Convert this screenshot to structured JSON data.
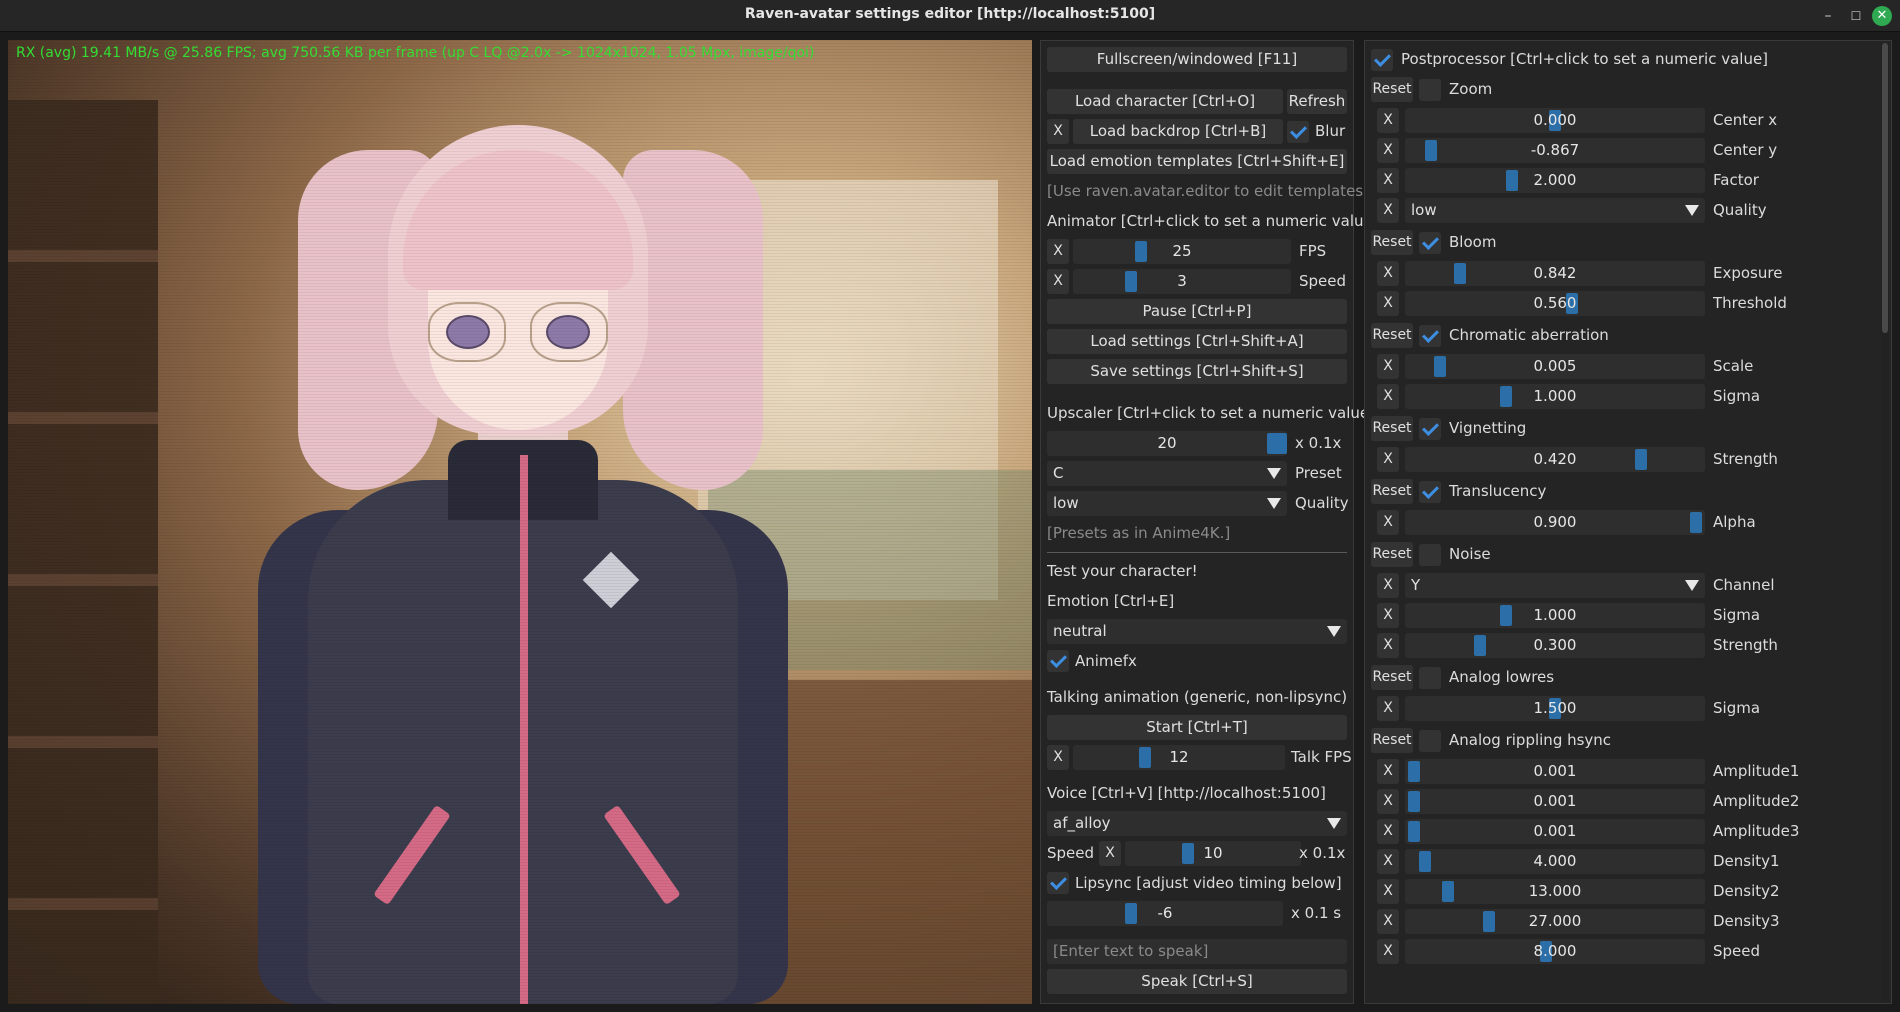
{
  "window": {
    "title": "Raven-avatar settings editor [http://localhost:5100]",
    "controls": {
      "minimize": "–",
      "maximize": "☐",
      "close": "✕"
    }
  },
  "viewport": {
    "stats": "RX (avg) 19.41 MB/s @ 25.86 FPS; avg 750.56 KB per frame (up C LQ @2.0x -> 1024x1024, 1.05 Mpx, image/qoi)"
  },
  "mid": {
    "fullscreen": "Fullscreen/windowed [F11]",
    "load_character": "Load character [Ctrl+O]",
    "refresh": "Refresh",
    "backdrop_x": "X",
    "load_backdrop": "Load backdrop [Ctrl+B]",
    "blur_label": "Blur",
    "blur_checked": true,
    "load_templates": "Load emotion templates [Ctrl+Shift+E]",
    "templates_hint": "[Use raven.avatar.editor to edit templates.]",
    "animator_header": "Animator [Ctrl+click to set a numeric value]",
    "fps": {
      "x": "X",
      "value": "25",
      "label": "FPS",
      "level": 0.3
    },
    "speed": {
      "x": "X",
      "value": "3",
      "label": "Speed",
      "level": 0.25
    },
    "pause": "Pause [Ctrl+P]",
    "load_settings": "Load settings [Ctrl+Shift+A]",
    "save_settings": "Save settings [Ctrl+Shift+S]",
    "upscaler_header": "Upscaler [Ctrl+click to set a numeric value]",
    "upscale": {
      "value": "20",
      "label": "x 0.1x",
      "level": 1.0
    },
    "preset": {
      "value": "C",
      "label": "Preset"
    },
    "quality": {
      "value": "low",
      "label": "Quality"
    },
    "presets_hint": "[Presets as in Anime4K.]",
    "test_header": "Test your character!",
    "emotion_label": "Emotion [Ctrl+E]",
    "emotion_value": "neutral",
    "animefx_label": "Animefx",
    "animefx_checked": true,
    "talking_header": "Talking animation (generic, non-lipsync)",
    "start": "Start [Ctrl+T]",
    "talk_fps": {
      "x": "X",
      "value": "12",
      "label": "Talk FPS",
      "level": 0.33
    },
    "voice_header": "Voice [Ctrl+V] [http://localhost:5100]",
    "voice_value": "af_alloy",
    "voice_speed": {
      "label": "Speed",
      "x": "X",
      "value": "10",
      "unit": "x 0.1x",
      "level": 0.35
    },
    "lipsync_label": "Lipsync [adjust video timing below]",
    "lipsync_checked": true,
    "lipsync_offset": {
      "value": "-6",
      "unit": "x 0.1 s",
      "level": 0.35
    },
    "speak_placeholder": "[Enter text to speak]",
    "speak": "Speak [Ctrl+S]"
  },
  "right": {
    "postprocessor_label": "Postprocessor [Ctrl+click to set a numeric value]",
    "postprocessor_checked": true,
    "reset": "Reset",
    "x": "X",
    "sections": [
      {
        "name": "Zoom",
        "checked": false,
        "rows": [
          {
            "kind": "slider",
            "value": "0.000",
            "label": "Center x",
            "level": 0.5
          },
          {
            "kind": "slider",
            "value": "-0.867",
            "label": "Center y",
            "level": 0.07
          },
          {
            "kind": "slider",
            "value": "2.000",
            "label": "Factor",
            "level": 0.35
          },
          {
            "kind": "combo",
            "value": "low",
            "label": "Quality"
          }
        ]
      },
      {
        "name": "Bloom",
        "checked": true,
        "rows": [
          {
            "kind": "slider",
            "value": "0.842",
            "label": "Exposure",
            "level": 0.17
          },
          {
            "kind": "slider",
            "value": "0.560",
            "label": "Threshold",
            "level": 0.56
          }
        ]
      },
      {
        "name": "Chromatic aberration",
        "checked": true,
        "rows": [
          {
            "kind": "slider",
            "value": "0.005",
            "label": "Scale",
            "level": 0.1
          },
          {
            "kind": "slider",
            "value": "1.000",
            "label": "Sigma",
            "level": 0.33
          }
        ]
      },
      {
        "name": "Vignetting",
        "checked": true,
        "rows": [
          {
            "kind": "slider",
            "value": "0.420",
            "label": "Strength",
            "level": 0.8
          }
        ]
      },
      {
        "name": "Translucency",
        "checked": true,
        "rows": [
          {
            "kind": "slider",
            "value": "0.900",
            "label": "Alpha",
            "level": 0.99
          }
        ]
      },
      {
        "name": "Noise",
        "checked": false,
        "rows": [
          {
            "kind": "combo",
            "value": "Y",
            "label": "Channel"
          },
          {
            "kind": "slider",
            "value": "1.000",
            "label": "Sigma",
            "level": 0.33
          },
          {
            "kind": "slider",
            "value": "0.300",
            "label": "Strength",
            "level": 0.24
          }
        ]
      },
      {
        "name": "Analog lowres",
        "checked": false,
        "rows": [
          {
            "kind": "slider",
            "value": "1.500",
            "label": "Sigma",
            "level": 0.5
          }
        ]
      },
      {
        "name": "Analog rippling hsync",
        "checked": false,
        "rows": [
          {
            "kind": "slider",
            "value": "0.001",
            "label": "Amplitude1",
            "level": 0.01
          },
          {
            "kind": "slider",
            "value": "0.001",
            "label": "Amplitude2",
            "level": 0.01
          },
          {
            "kind": "slider",
            "value": "0.001",
            "label": "Amplitude3",
            "level": 0.01
          },
          {
            "kind": "slider",
            "value": "4.000",
            "label": "Density1",
            "level": 0.05
          },
          {
            "kind": "slider",
            "value": "13.000",
            "label": "Density2",
            "level": 0.13
          },
          {
            "kind": "slider",
            "value": "27.000",
            "label": "Density3",
            "level": 0.27
          },
          {
            "kind": "slider",
            "value": "8.000",
            "label": "Speed",
            "level": 0.47
          }
        ]
      }
    ]
  },
  "colors": {
    "stats_text": "#33dd33",
    "accent": "#2b6ea8",
    "check": "#3d8ee0",
    "close_button": "#2faa52"
  }
}
